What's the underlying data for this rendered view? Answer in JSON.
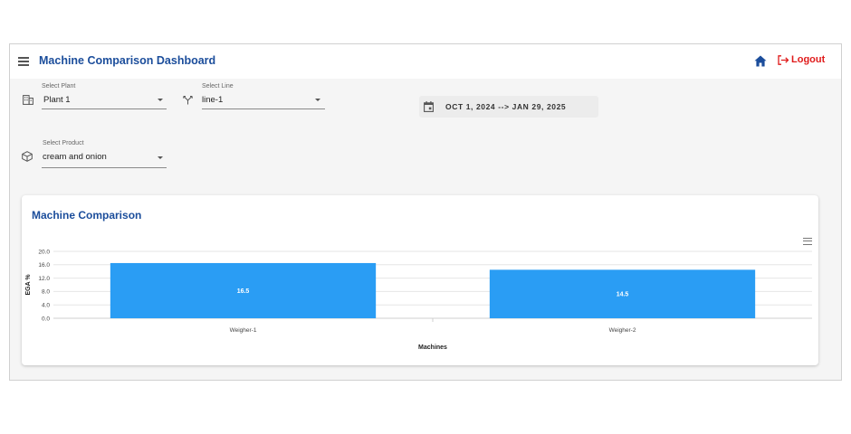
{
  "header": {
    "title": "Machine Comparison Dashboard",
    "logout_label": "Logout"
  },
  "filters": {
    "plant": {
      "label": "Select Plant",
      "value": "Plant 1"
    },
    "line": {
      "label": "Select Line",
      "value": "line-1"
    },
    "product": {
      "label": "Select Product",
      "value": "cream and onion"
    },
    "date_range": "OCT 1, 2024 --> JAN 29, 2025"
  },
  "card": {
    "title": "Machine Comparison"
  },
  "chart_data": {
    "type": "bar",
    "categories": [
      "Weigher-1",
      "Weigher-2"
    ],
    "values": [
      16.5,
      14.5
    ],
    "data_labels": [
      "16.5",
      "14.5"
    ],
    "xlabel": "Machines",
    "ylabel": "EGA %",
    "ylim": [
      0,
      20
    ],
    "y_ticks": [
      "0.0",
      "4.0",
      "8.0",
      "12.0",
      "16.0",
      "20.0"
    ],
    "bar_color": "#2a9df4",
    "grid": true
  }
}
